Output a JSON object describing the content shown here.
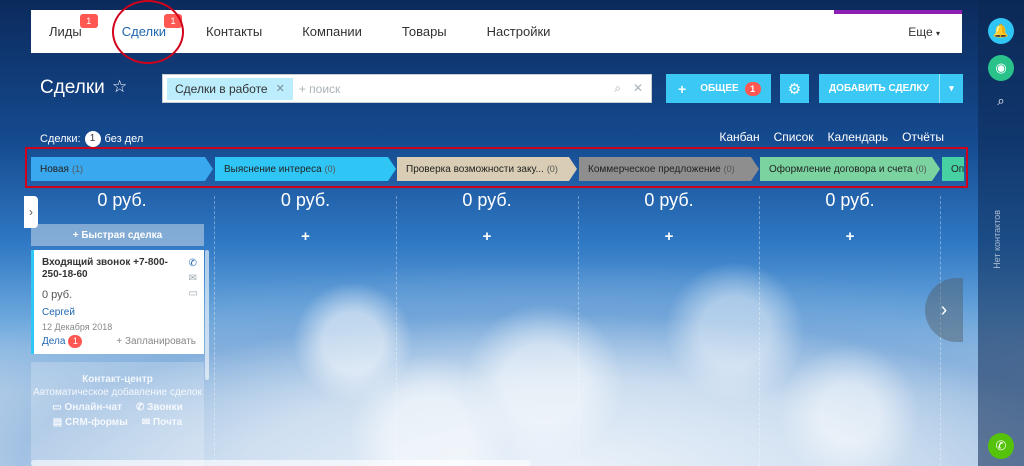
{
  "nav": {
    "items": [
      {
        "label": "Лиды",
        "badge": "1"
      },
      {
        "label": "Сделки",
        "badge": "1"
      },
      {
        "label": "Контакты",
        "badge": ""
      },
      {
        "label": "Компании",
        "badge": ""
      },
      {
        "label": "Товары",
        "badge": ""
      },
      {
        "label": "Настройки",
        "badge": ""
      }
    ],
    "more": "Еще"
  },
  "page": {
    "title": "Сделки",
    "filter_chip": "Сделки в работе",
    "search_placeholder": "+ поиск",
    "general_button": "ОБЩЕЕ",
    "general_count": "1",
    "add_deal_button": "ДОБАВИТЬ СДЕЛКУ"
  },
  "summary": {
    "label": "Сделки:",
    "count": "1",
    "suffix": "без дел"
  },
  "views": [
    "Канбан",
    "Список",
    "Календарь",
    "Отчёты"
  ],
  "stages": [
    {
      "name": "Новая",
      "count": "(1)",
      "color": "#39a8ef"
    },
    {
      "name": "Выяснение интереса",
      "count": "(0)",
      "color": "#2fc6f6"
    },
    {
      "name": "Проверка возможности заку...",
      "count": "(0)",
      "color": "#d9ceb5"
    },
    {
      "name": "Коммерческое предложение",
      "count": "(0)",
      "color": "#8e8e8e"
    },
    {
      "name": "Оформление договора и счета",
      "count": "(0)",
      "color": "#7bd4a0"
    },
    {
      "name": "Оп",
      "count": "",
      "color": "#47d1a3"
    }
  ],
  "columns": {
    "sums": [
      "0 руб.",
      "0 руб.",
      "0 руб.",
      "0 руб.",
      "0 руб."
    ],
    "plus": "+"
  },
  "quick_deal": "+ Быстрая сделка",
  "deal_card": {
    "title": "Входящий звонок +7-800-250-18-60",
    "sum": "0 руб.",
    "person": "Сергей",
    "date": "12 Декабря 2018",
    "tasks_label": "Дела",
    "tasks_count": "1",
    "plan_label": "+ Запланировать"
  },
  "contact_center": {
    "title": "Контакт-центр",
    "subtitle": "Автоматическое добавление сделок",
    "items": [
      "Онлайн-чат",
      "Звонки",
      "CRM-формы",
      "Почта"
    ]
  },
  "right_panel": {
    "vertical_label": "Нет контактов"
  }
}
